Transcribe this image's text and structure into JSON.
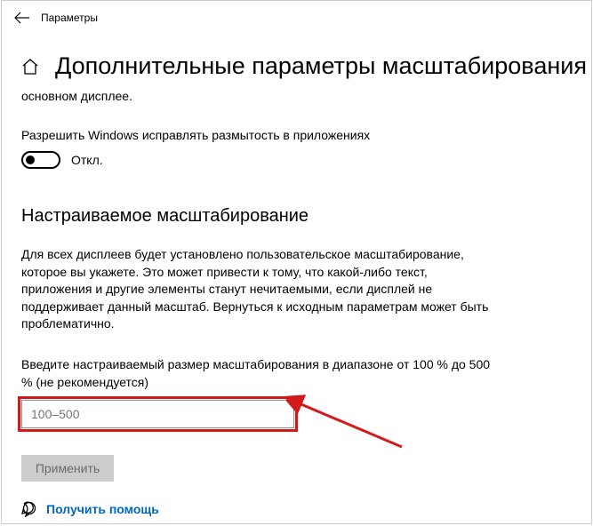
{
  "header": {
    "app_name": "Параметры"
  },
  "page": {
    "title": "Дополнительные параметры масштабирования",
    "truncated_line": "основном дисплее.",
    "allow_fix_label": "Разрешить Windows исправлять размытость в приложениях",
    "toggle_state": "Откл.",
    "section_heading": "Настраиваемое масштабирование",
    "section_desc": "Для всех дисплеев будет установлено пользовательское масштабирование, которое вы укажете. Это может привести к тому, что какой-либо текст, приложения и другие элементы станут нечитаемыми, если дисплей не поддерживает данный масштаб. Вернуться к исходным параметрам может быть проблематично.",
    "input_hint": "Введите настраиваемый размер масштабирования в диапазоне от 100 % до 500 % (не рекомендуется)",
    "input_placeholder": "100–500",
    "apply_label": "Применить",
    "help_label": "Получить помощь"
  }
}
